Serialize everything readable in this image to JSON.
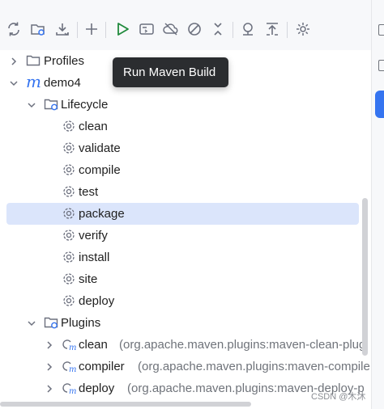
{
  "toolbar": {
    "buttons": [
      {
        "name": "reload-all-projects-button",
        "icon": "reload-icon"
      },
      {
        "name": "generate-sources-button",
        "icon": "folder-refresh-icon"
      },
      {
        "name": "download-sources-button",
        "icon": "download-icon"
      },
      {
        "name": "add-maven-project-button",
        "icon": "plus-icon"
      },
      {
        "name": "run-maven-build-button",
        "icon": "run-icon"
      },
      {
        "name": "execute-goal-button",
        "icon": "terminal-icon"
      },
      {
        "name": "toggle-offline-mode-button",
        "icon": "cloud-off-icon"
      },
      {
        "name": "skip-tests-button",
        "icon": "skip-icon"
      },
      {
        "name": "collapse-all-button",
        "icon": "collapse-icon"
      },
      {
        "name": "show-dependencies-button",
        "icon": "dependencies-icon"
      },
      {
        "name": "show-diagram-button",
        "icon": "align-top-icon"
      },
      {
        "name": "settings-button",
        "icon": "gear-icon"
      }
    ]
  },
  "tooltip": {
    "text": "Run Maven Build"
  },
  "tree": {
    "profiles": {
      "label": "Profiles",
      "expanded": false
    },
    "project": {
      "label": "demo4",
      "expanded": true
    },
    "lifecycle": {
      "label": "Lifecycle",
      "expanded": true,
      "goals": [
        "clean",
        "validate",
        "compile",
        "test",
        "package",
        "verify",
        "install",
        "site",
        "deploy"
      ],
      "selected": "package"
    },
    "plugins": {
      "label": "Plugins",
      "expanded": true,
      "items": [
        {
          "name": "clean",
          "detail": "(org.apache.maven.plugins:maven-clean-plug"
        },
        {
          "name": "compiler",
          "detail": "(org.apache.maven.plugins:maven-compile"
        },
        {
          "name": "deploy",
          "detail": "(org.apache.maven.plugins:maven-deploy-p"
        }
      ]
    }
  },
  "watermark": "CSDN @木沐",
  "colors": {
    "accent": "#3574f0",
    "run_green": "#208a3c",
    "selection": "#dbe5fb",
    "tooltip_bg": "#2b2d30"
  }
}
